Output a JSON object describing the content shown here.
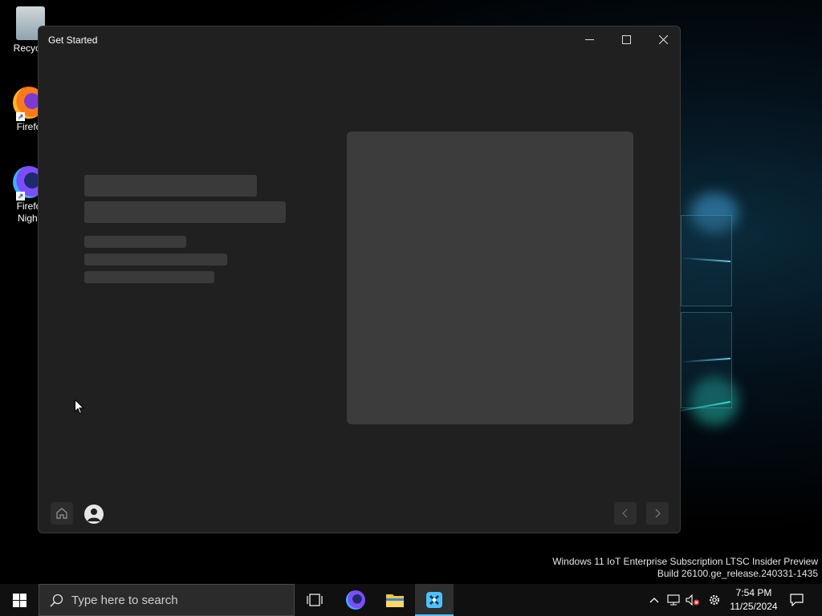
{
  "desktop": {
    "icons": [
      {
        "label": "Recycle"
      },
      {
        "label": "Firefo"
      },
      {
        "label_line1": "Firefo",
        "label_line2": "Night"
      }
    ],
    "shortcut_glyph": "↗"
  },
  "window": {
    "title": "Get Started",
    "controls": {
      "minimize": "—",
      "maximize": "☐",
      "close": "✕"
    }
  },
  "watermark": {
    "line1": "Windows 11 IoT Enterprise Subscription LTSC Insider Preview",
    "line2": "Build 26100.ge_release.240331-1435"
  },
  "taskbar": {
    "search_placeholder": "Type here to search",
    "clock_time": "7:54 PM",
    "clock_date": "11/25/2024"
  },
  "colors": {
    "accent": "#4cc2ff",
    "window_bg": "#202020",
    "skeleton": "#3a3a3a"
  }
}
